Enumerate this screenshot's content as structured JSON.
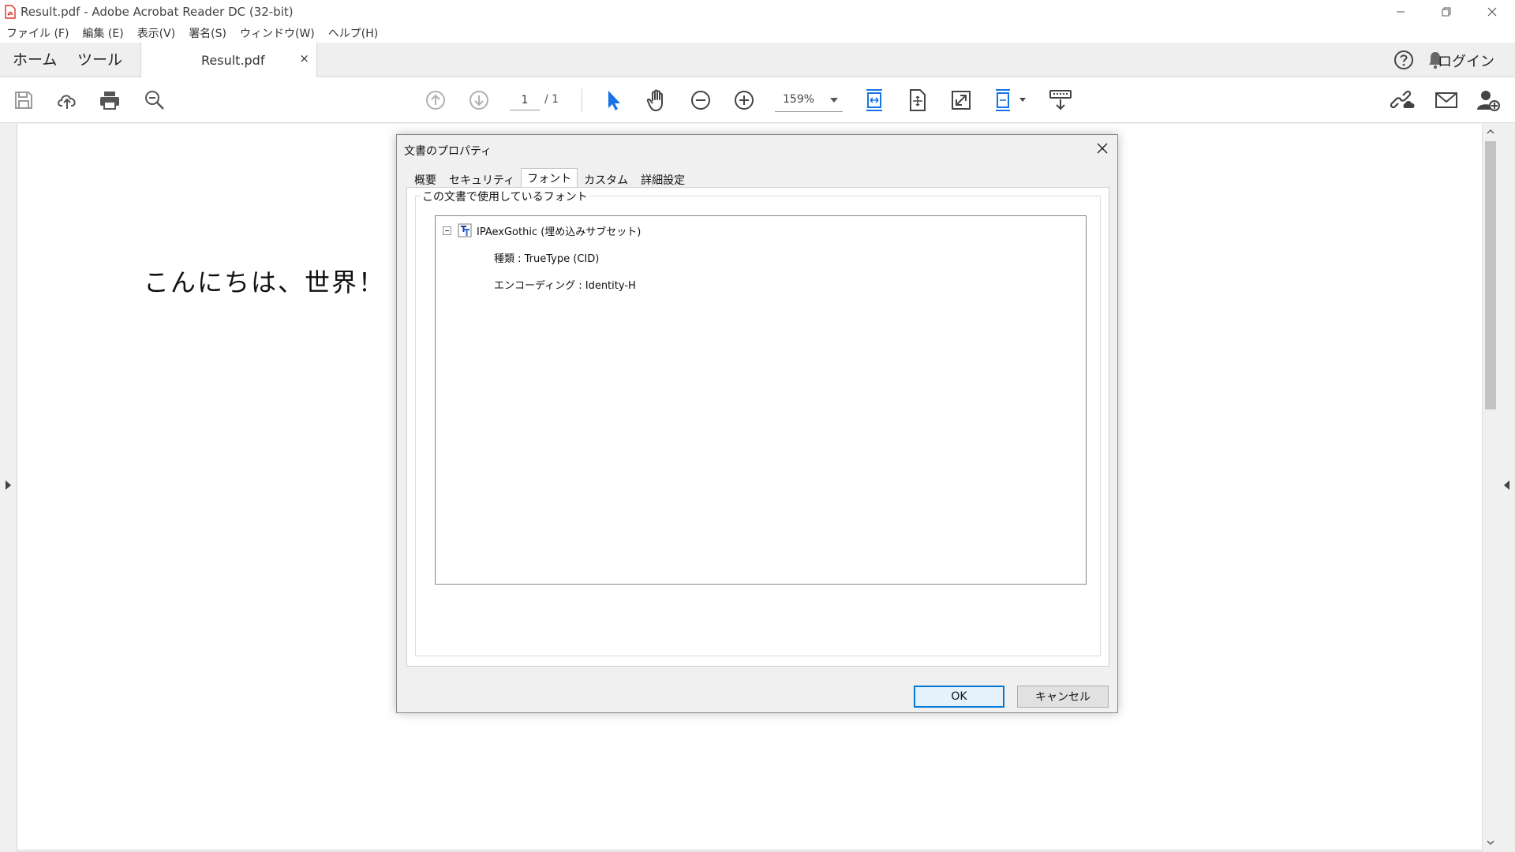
{
  "window": {
    "title": "Result.pdf - Adobe Acrobat Reader DC (32-bit)"
  },
  "menubar": {
    "items": [
      "ファイル (F)",
      "編集 (E)",
      "表示(V)",
      "署名(S)",
      "ウィンドウ(W)",
      "ヘルプ(H)"
    ]
  },
  "tabbar": {
    "home": "ホーム",
    "tools": "ツール",
    "doc_tab": "Result.pdf",
    "close": "×",
    "login": "ログイン"
  },
  "toolbar": {
    "page_current": "1",
    "page_total": "/ 1",
    "zoom": "159%"
  },
  "document": {
    "text": "こんにちは、世界！"
  },
  "dialog": {
    "title": "文書のプロパティ",
    "tabs": [
      "概要",
      "セキュリティ",
      "フォント",
      "カスタム",
      "詳細設定"
    ],
    "active_tab": "フォント",
    "group_label": "この文書で使用しているフォント",
    "font": {
      "name": "IPAexGothic (埋め込みサブセット)",
      "type": "種類 : TrueType (CID)",
      "encoding": "エンコーディング : Identity-H"
    },
    "ok": "OK",
    "cancel": "キャンセル"
  },
  "colors": {
    "accent": "#0078d7",
    "tool_blue": "#1473e6",
    "pdf_red": "#d9362b"
  }
}
